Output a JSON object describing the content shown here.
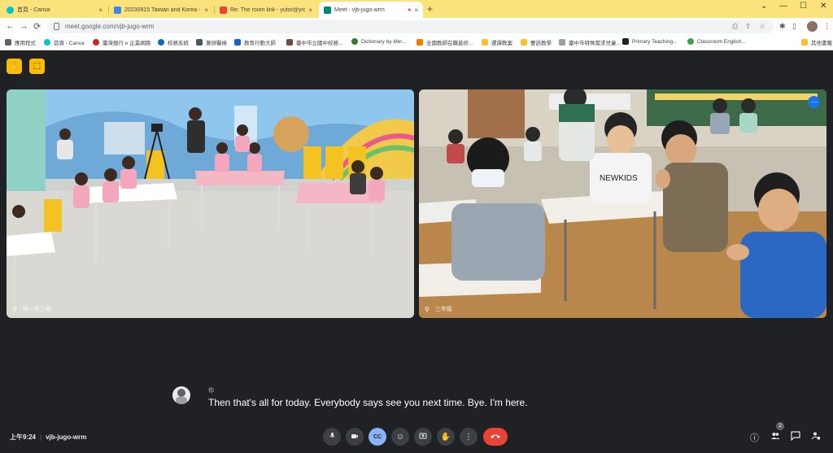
{
  "browser": {
    "tabs": [
      {
        "title": "首頁 - Canva",
        "close": "×",
        "favicon_color": "#00c4cc"
      },
      {
        "title": "20230915 Taiwan and Korea - G",
        "close": "×",
        "favicon_color": "#4285f4"
      },
      {
        "title": "Re: The room link - yutor@yrc",
        "close": "×",
        "favicon_color": "#ea4335"
      },
      {
        "title": "Meet - vjb-jugo-wrm",
        "close": "×",
        "favicon_color": "#00897b",
        "recording_dot": "●"
      }
    ],
    "new_tab": "+",
    "window_controls": [
      "⌄",
      "—",
      "☐",
      "✕"
    ],
    "nav": {
      "back": "←",
      "forward": "→",
      "reload": "⟳"
    },
    "url": "meet.google.com/vjb-jugo-wrm",
    "omnibox_icons": [
      "⎙",
      "⇪",
      "☆"
    ],
    "toolbar_icons": [
      "✱",
      "▯",
      "◧"
    ],
    "bookmarks": [
      {
        "label": "應用程式",
        "color": "#5f6368"
      },
      {
        "label": "首頁 - Canva",
        "color": "#00c4cc"
      },
      {
        "label": "臺灣銀行 e 企業網路",
        "color": "#c62828"
      },
      {
        "label": "校務系統",
        "color": "#1565c0"
      },
      {
        "label": "兼辦醫檢",
        "color": "#455a64"
      },
      {
        "label": "教育行動大師",
        "color": "#1565c0"
      },
      {
        "label": "臺中市立國中校務...",
        "color": "#6d4c41"
      },
      {
        "label": "Dictionary by Mer...",
        "color": "#2e7d32"
      },
      {
        "label": "全國教師在職進修...",
        "color": "#f57c00"
      },
      {
        "label": "選課教案",
        "color": "#fbc02d"
      },
      {
        "label": "雙語教學",
        "color": "#fbc02d"
      },
      {
        "label": "臺中市特殊需求兒童...",
        "color": "#9e9e9e"
      },
      {
        "label": "Primary Teaching...",
        "color": "#212121"
      },
      {
        "label": "Classroom English...",
        "color": "#43a047"
      }
    ],
    "other_bookmarks": "其他書籤"
  },
  "meet": {
    "top_buttons": [
      "✋",
      "⬚"
    ],
    "tiles": [
      {
        "name": "林一年三班"
      },
      {
        "name": "三年級"
      }
    ],
    "right_tile_more": "⋯",
    "caption": {
      "speaker": "你",
      "text": "Then that's all for today. Everybody says see you next time. Bye. I'm here."
    },
    "time": "上午9:24",
    "separator": "|",
    "meeting_code": "vjb-jugo-wrm",
    "controls": [
      {
        "name": "mic",
        "icon": "🎙"
      },
      {
        "name": "camera",
        "icon": "▭"
      },
      {
        "name": "captions",
        "icon": "CC"
      },
      {
        "name": "emoji",
        "icon": "☺"
      },
      {
        "name": "present",
        "icon": "⬆"
      },
      {
        "name": "raise-hand",
        "icon": "✋"
      },
      {
        "name": "more",
        "icon": "⋮"
      },
      {
        "name": "end-call",
        "icon": "☎"
      }
    ],
    "right_controls": [
      "ⓘ",
      "👥",
      "💬",
      "⚇"
    ],
    "people_count": "2"
  },
  "colors": {
    "tabbar": "#fbe27a",
    "meet_bg": "#202124",
    "accent_yellow": "#fbbc04",
    "end_call": "#ea4335",
    "captions_active": "#8ab4f8"
  }
}
